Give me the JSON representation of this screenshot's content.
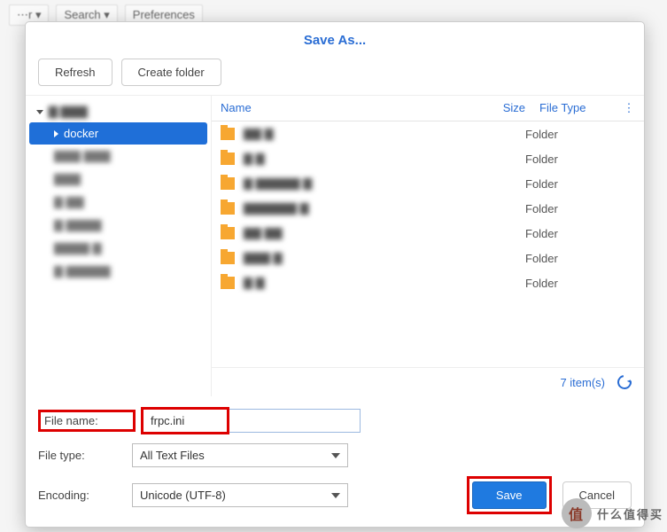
{
  "backdrop": {
    "menus": [
      "⋯r ▾",
      "Search ▾",
      "Preferences"
    ]
  },
  "dialog": {
    "title": "Save As...",
    "toolbar": {
      "refresh": "Refresh",
      "create_folder": "Create folder"
    },
    "tree": {
      "root": "▇ ▇▇▇",
      "items": [
        {
          "label": "docker",
          "selected": true
        },
        {
          "label": "▇▇▇ ▇▇▇"
        },
        {
          "label": "▇▇▇"
        },
        {
          "label": "▇ ▇▇"
        },
        {
          "label": "▇ ▇▇▇▇"
        },
        {
          "label": "▇▇▇▇ ▇"
        },
        {
          "label": "▇ ▇▇▇▇▇"
        }
      ]
    },
    "columns": {
      "name": "Name",
      "size": "Size",
      "type": "File Type"
    },
    "rows": [
      {
        "name": "▇▇ ▇",
        "type": "Folder"
      },
      {
        "name": "▇ ▇",
        "type": "Folder"
      },
      {
        "name": "▇ ▇▇▇▇▇ ▇",
        "type": "Folder"
      },
      {
        "name": "▇▇▇▇▇▇ ▇",
        "type": "Folder"
      },
      {
        "name": "▇▇ ▇▇",
        "type": "Folder"
      },
      {
        "name": "▇▇▇ ▇",
        "type": "Folder"
      },
      {
        "name": "▇ ▇",
        "type": "Folder"
      }
    ],
    "footer": {
      "count": "7 item(s)"
    },
    "form": {
      "filename_label": "File name:",
      "filename_value": "frpc.ini",
      "filetype_label": "File type:",
      "filetype_value": "All Text Files",
      "encoding_label": "Encoding:",
      "encoding_value": "Unicode (UTF-8)"
    },
    "actions": {
      "save": "Save",
      "cancel": "Cancel"
    }
  },
  "watermark": {
    "badge": "值",
    "text": "什么值得买"
  }
}
